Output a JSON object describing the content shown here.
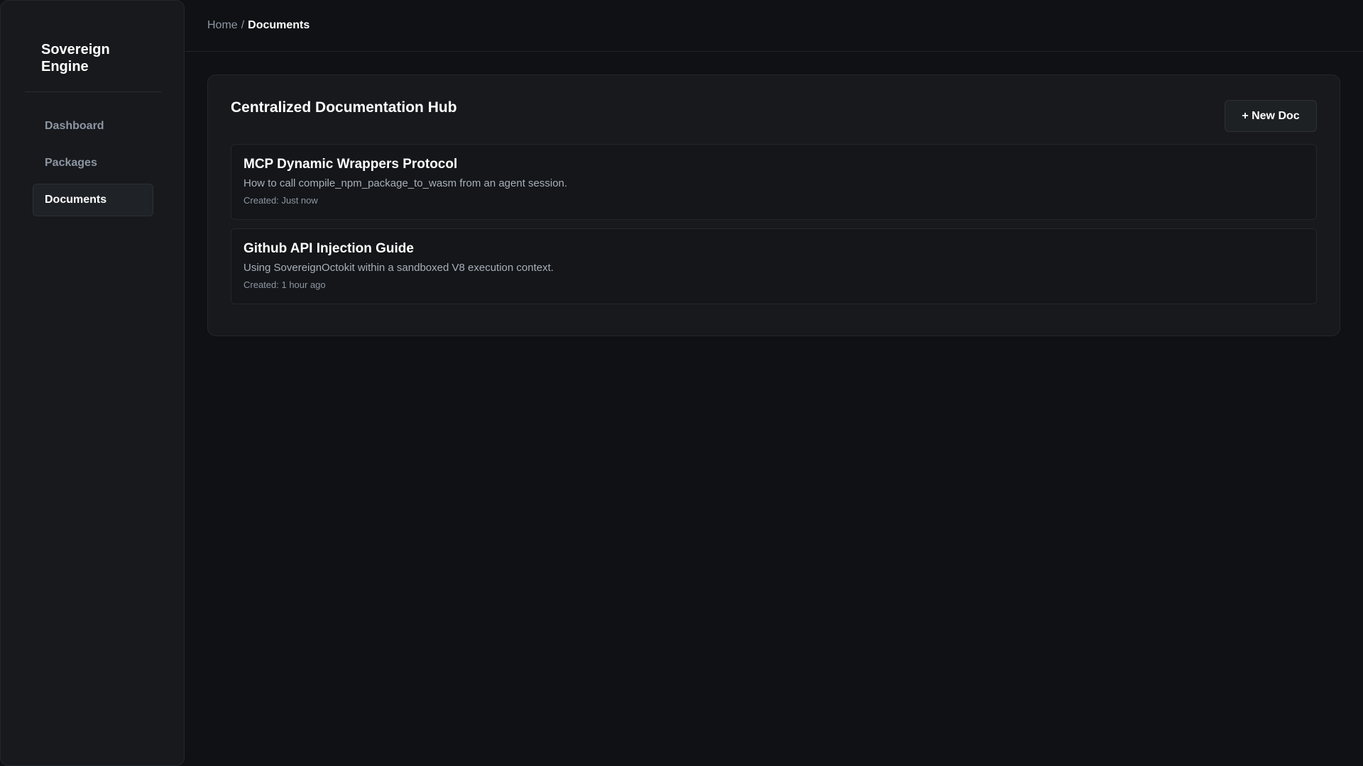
{
  "sidebar": {
    "brand": "Sovereign Engine",
    "items": [
      {
        "label": "Dashboard",
        "active": false
      },
      {
        "label": "Packages",
        "active": false
      },
      {
        "label": "Documents",
        "active": true
      }
    ]
  },
  "header": {
    "breadcrumb": {
      "home": "Home",
      "separator": "/",
      "current": "Documents"
    }
  },
  "main": {
    "title": "Centralized Documentation Hub",
    "new_doc_label": "+ New Doc",
    "documents": [
      {
        "title": "MCP Dynamic Wrappers Protocol",
        "description": "How to call compile_npm_package_to_wasm from an agent session.",
        "created": "Created: Just now"
      },
      {
        "title": "Github API Injection Guide",
        "description": "Using SovereignOctokit within a sandboxed V8 execution context.",
        "created": "Created: 1 hour ago"
      }
    ]
  },
  "colors": {
    "background": "#0f1114",
    "surface": "#17191c",
    "border": "#24272b",
    "text_primary": "#ffffff",
    "text_muted": "#8d96a3"
  }
}
